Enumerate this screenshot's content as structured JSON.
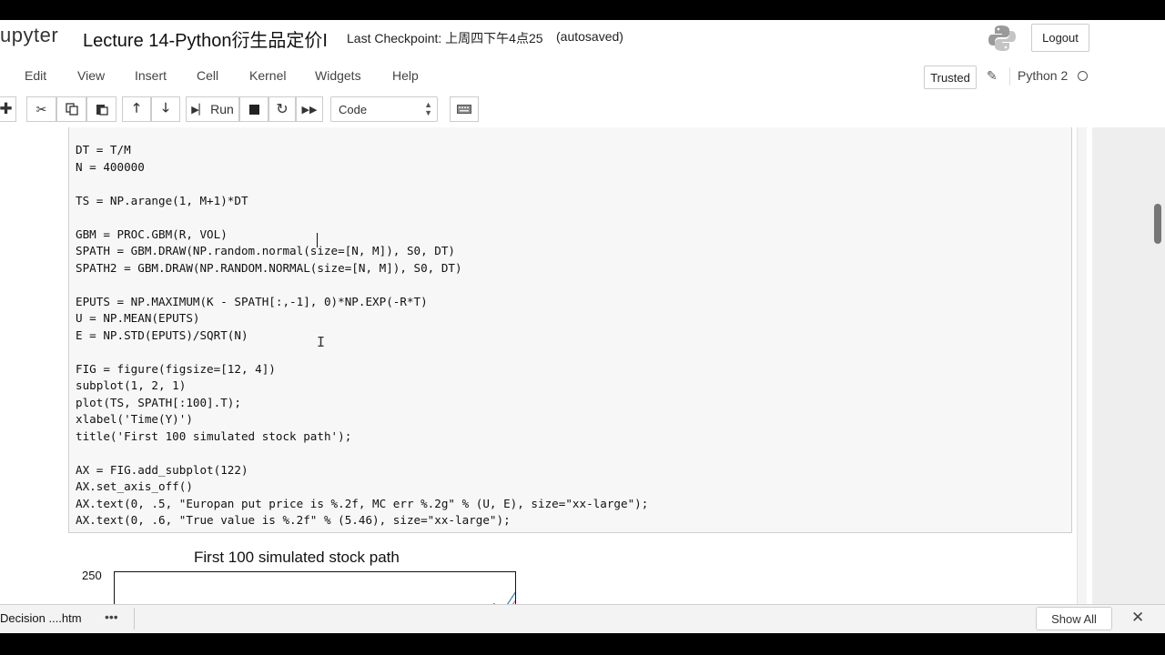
{
  "header": {
    "logo_text": "upyter",
    "notebook_name": "Lecture 14-Python衍生品定价I",
    "checkpoint": "Last Checkpoint: 上周四下午4点25",
    "autosave_status": "(autosaved)",
    "logout_label": "Logout"
  },
  "menubar": {
    "items": [
      {
        "label": "Edit"
      },
      {
        "label": "View"
      },
      {
        "label": "Insert"
      },
      {
        "label": "Cell"
      },
      {
        "label": "Kernel"
      },
      {
        "label": "Widgets"
      },
      {
        "label": "Help"
      }
    ],
    "trusted_label": "Trusted",
    "kernel_name": "Python 2"
  },
  "toolbar": {
    "add_icon": "plus-icon",
    "cut_icon": "scissors-icon",
    "copy_icon": "copy-icon",
    "paste_icon": "paste-icon",
    "move_up_icon": "arrow-up-icon",
    "move_down_icon": "arrow-down-icon",
    "run_label": "Run",
    "run_icon": "step-forward-icon",
    "stop_icon": "stop-icon",
    "restart_icon": "refresh-icon",
    "restart_run_all_icon": "fast-forward-icon",
    "cell_type": "Code",
    "keyboard_icon": "keyboard-icon"
  },
  "code_cell": {
    "lines": [
      "DT = T/M",
      "N = 400000",
      "",
      "TS = NP.arange(1, M+1)*DT",
      "",
      "GBM = PROC.GBM(R, VOL)",
      "SPATH = GBM.DRAW(NP.random.normal(size=[N, M]), S0, DT)",
      "SPATH2 = GBM.DRAW(NP.RANDOM.NORMAL(size=[N, M]), S0, DT)",
      "",
      "EPUTS = NP.MAXIMUM(K - SPATH[:,-1], 0)*NP.EXP(-R*T)",
      "U = NP.MEAN(EPUTS)",
      "E = NP.STD(EPUTS)/SQRT(N)",
      "",
      "FIG = figure(figsize=[12, 4])",
      "subplot(1, 2, 1)",
      "plot(TS, SPATH[:100].T);",
      "xlabel('Time(Y)')",
      "title('First 100 simulated stock path');",
      "",
      "AX = FIG.add_subplot(122)",
      "AX.set_axis_off()",
      "AX.text(0, .5, \"Europan put price is %.2f, MC err %.2g\" % (U, E), size=\"xx-large\");",
      "AX.text(0, .6, \"True value is %.2f\" % (5.46), size=\"xx-large\");"
    ]
  },
  "output": {
    "chart_data": {
      "type": "line",
      "title": "First 100 simulated stock path",
      "y_tick_labels": [
        "250"
      ],
      "ylim_top": 250,
      "visible_portion": "top edge of the plot only"
    }
  },
  "download_bar": {
    "file_label": "Decision ....htm",
    "menu_glyph": "•••",
    "show_all_label": "Show All",
    "close_glyph": "✕"
  }
}
